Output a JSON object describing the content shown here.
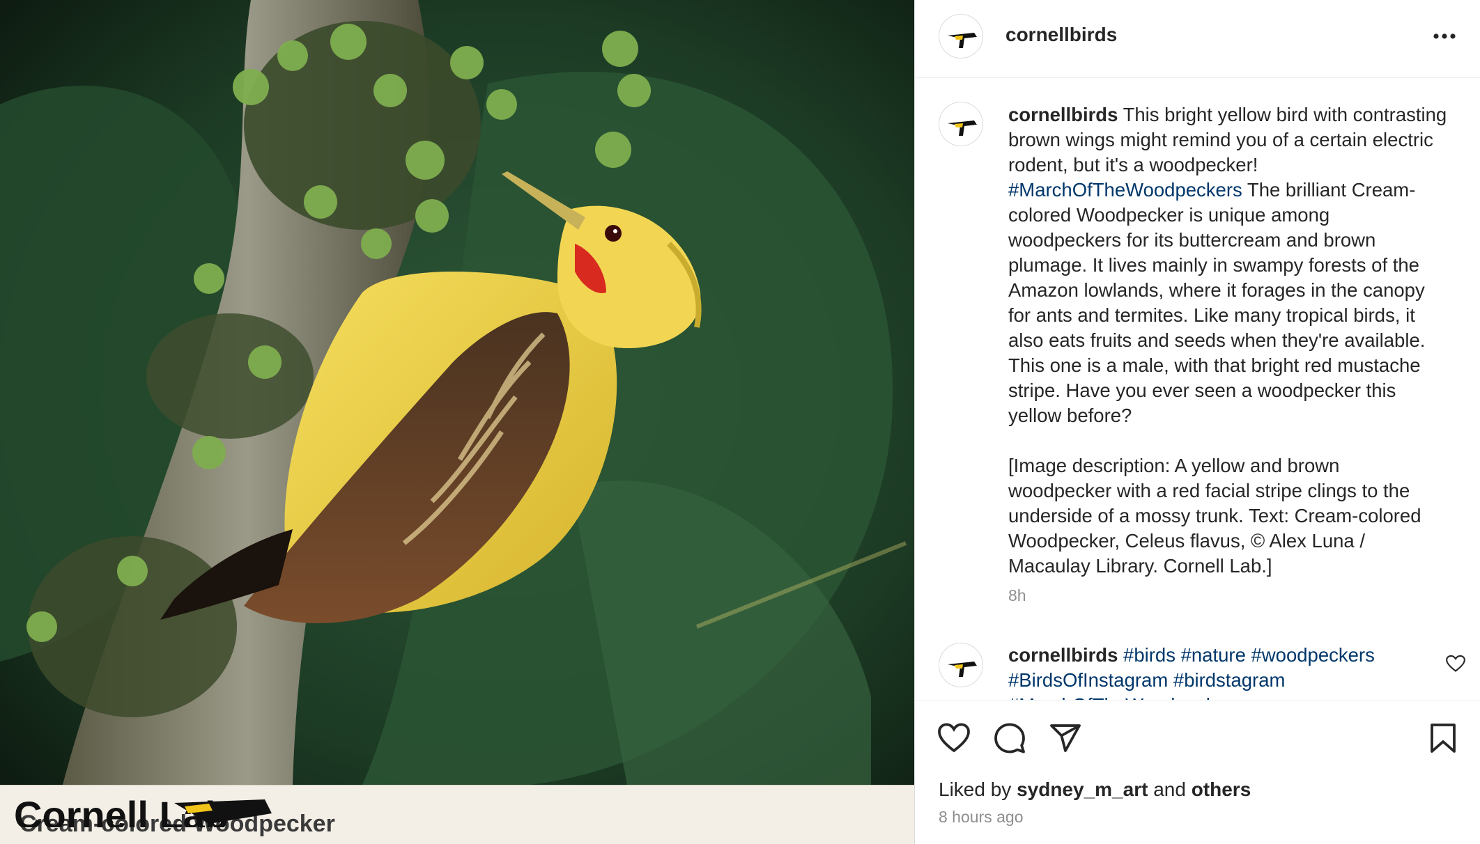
{
  "photo": {
    "caption_title": "Cream-colored Woodpecker",
    "watermark_text": "Cornell Lab"
  },
  "post": {
    "header_username": "cornellbirds",
    "caption": {
      "username": "cornellbirds",
      "text_1": "This bright yellow bird with contrasting brown wings might remind you of a certain electric rodent, but it's a woodpecker!",
      "hashtag_1": "#MarchOfTheWoodpeckers",
      "text_2": "The brilliant Cream-colored Woodpecker is unique among woodpeckers for its buttercream and brown plumage. It lives mainly in swampy forests of the Amazon lowlands, where it forages in the canopy for ants and termites. Like many tropical birds, it also eats fruits and seeds when they're available. This one is a male, with that bright red mustache stripe. Have you ever seen a woodpecker this yellow before?",
      "image_description": "[Image description: A yellow and brown woodpecker with a red facial stripe clings to the underside of a mossy trunk. Text: Cream-colored Woodpecker, Celeus flavus, © Alex Luna / Macaulay Library. Cornell Lab.]",
      "time": "8h"
    },
    "comment": {
      "username": "cornellbirds",
      "hashtags": [
        "#birds",
        "#nature",
        "#woodpeckers",
        "#BirdsOfInstagram",
        "#birdstagram",
        "#MarchOfTheWoodpeckers"
      ]
    },
    "likes": {
      "prefix": "Liked by",
      "user": "sydney_m_art",
      "and": "and",
      "others": "others"
    },
    "time_ago": "8 hours ago"
  },
  "icons": {
    "like": "heart-icon",
    "comment": "comment-bubble-icon",
    "share": "paper-plane-icon",
    "save": "bookmark-icon",
    "more": "ellipsis-icon"
  },
  "colors": {
    "hashtag": "#00376b",
    "muted": "#8e8e8e",
    "text": "#262626",
    "caption_strip": "#f3efe6"
  }
}
